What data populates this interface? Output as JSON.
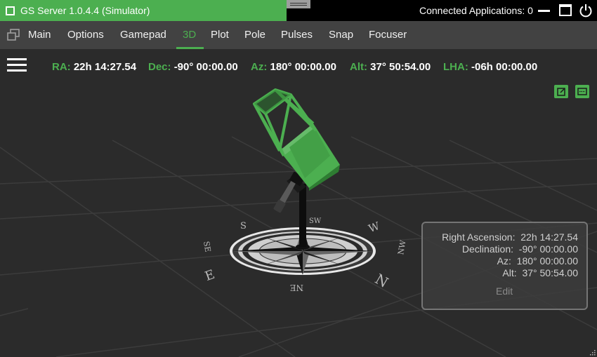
{
  "window": {
    "title": "GS Server 1.0.4.4 (Simulator)",
    "connected_label": "Connected Applications: 0"
  },
  "tabs": [
    "Main",
    "Options",
    "Gamepad",
    "3D",
    "Plot",
    "Pole",
    "Pulses",
    "Snap",
    "Focuser"
  ],
  "active_tab": "3D",
  "coords": {
    "ra_label": "RA:",
    "ra": "22h 14:27.54",
    "dec_label": "Dec:",
    "dec": "-90° 00:00.00",
    "az_label": "Az:",
    "az": "180° 00:00.00",
    "alt_label": "Alt:",
    "alt": "37° 50:54.00",
    "lha_label": "LHA:",
    "lha": "-06h 00:00.00"
  },
  "info_panel": {
    "ra_label": "Right Ascension:",
    "ra": "22h 14:27.54",
    "dec_label": "Declination:",
    "dec": "-90° 00:00.00",
    "az_label": "Az:",
    "az": "180° 00:00.00",
    "alt_label": "Alt:",
    "alt": "37° 50:54.00",
    "edit_label": "Edit"
  },
  "compass_letters": {
    "s": "S",
    "w": "W",
    "n": "N",
    "e": "E",
    "se": "SE",
    "nw": "NW",
    "ne": "NE",
    "sw": "SW"
  },
  "colors": {
    "accent": "#4caf50",
    "background": "#2b2b2b",
    "tabbar": "#424242",
    "titlebar": "#000000"
  },
  "icons": {
    "window_check": "checkbox-icon",
    "minimize": "minimize-icon",
    "maximize": "maximize-icon",
    "power": "power-icon",
    "tab_menu": "windows-icon",
    "menu": "hamburger-icon",
    "popout": "popout-icon",
    "screen": "screen-icon"
  }
}
